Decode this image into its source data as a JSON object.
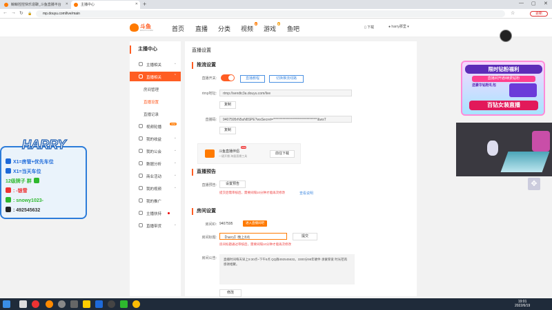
{
  "browser": {
    "tabs": [
      {
        "label": "鲸鲸控控快乐造聊_斗鱼直播平台"
      },
      {
        "label": "主播中心"
      }
    ],
    "url": "mp.douyu.com/live/main",
    "update_label": "更新"
  },
  "header": {
    "logo_text": "斗鱼",
    "logo_sub": "DOUYU.COM",
    "nav": [
      {
        "label": "首页"
      },
      {
        "label": "直播"
      },
      {
        "label": "分类"
      },
      {
        "label": "视频"
      },
      {
        "label": "游戏"
      },
      {
        "label": "鱼吧"
      }
    ],
    "download_label": "下载",
    "username": "harry那里"
  },
  "sidebar": {
    "title": "主播中心",
    "items": [
      {
        "label": "主播相关"
      },
      {
        "label": "直播相关"
      },
      {
        "label": "房间管理"
      },
      {
        "label": "直播设置"
      },
      {
        "label": "直播记录"
      },
      {
        "label": "视频轮播"
      },
      {
        "label": "我的收益"
      },
      {
        "label": "我的公会"
      },
      {
        "label": "数据分析"
      },
      {
        "label": "商业活动"
      },
      {
        "label": "我的视频"
      },
      {
        "label": "我的推广"
      },
      {
        "label": "主播扶持"
      },
      {
        "label": "直播带货"
      }
    ],
    "badge_new": "new"
  },
  "main": {
    "heading": "直播设置",
    "push": {
      "title": "推流设置",
      "switch_label": "直播开关:",
      "doc_link": "直播教程",
      "hint_link": "切换推流线路",
      "rtmp_label": "rtmp地址:",
      "rtmp_value": "rtmp://sendtc3a.douyu.com/live",
      "copy1": "复制",
      "code_label": "直播码:",
      "code_value": "9407595rN5uN8SPE?wsSecret=*********************************&wsT",
      "copy2": "复制",
      "companion_title": "斗鱼直播伴侣",
      "companion_sub": "一键开播 海量直播工具",
      "companion_new": "new",
      "companion_btn": "前往下载"
    },
    "notice": {
      "title": "直播预告",
      "label": "直播预告:",
      "btn": "设置预告",
      "warn": "提交后需审核后，需要间隔10分钟才能再次修改",
      "link": "查看说明"
    },
    "room": {
      "title": "房间设置",
      "id_label": "房间ID:",
      "id_value": "9407595",
      "enter_btn": "进入直播间吧",
      "title_label": "房间标题:",
      "title_value": "【harry】晚上8点",
      "submit": "提交",
      "warn": "房间标题通过审核后，需要间隔10分钟才能再次修改",
      "announce_label": "房间公告:",
      "announce_value": "直播时间每天早上9:30点~下午5点 QQ群492545632。3300分98年硬件 承蒙厚爱 时光荏苒 感谢相聚。",
      "modify": "修改"
    }
  },
  "overlay": {
    "name": "HARRY",
    "lines": [
      {
        "text": "X1=房管+优先车位",
        "color": "#1e6ad9"
      },
      {
        "text": "X1=当天车位",
        "color": "#1e6ad9"
      },
      {
        "text": "12级牌子 群",
        "color": "#2eb82e"
      },
      {
        "text": ": -银雪",
        "color": "#e33"
      },
      {
        "text": ": snowy1023-",
        "color": "#2eb82e"
      },
      {
        "text": ": 492545632",
        "color": "#333"
      }
    ],
    "promo_head": "限时钻粉福利",
    "promo_l2": "直播间开通/续费钻粉",
    "promo_l3": "送豪华钻粉礼包",
    "promo_l4": "百钻女装直播"
  },
  "taskbar": {
    "time": "19:01",
    "date": "2022/6/19"
  }
}
